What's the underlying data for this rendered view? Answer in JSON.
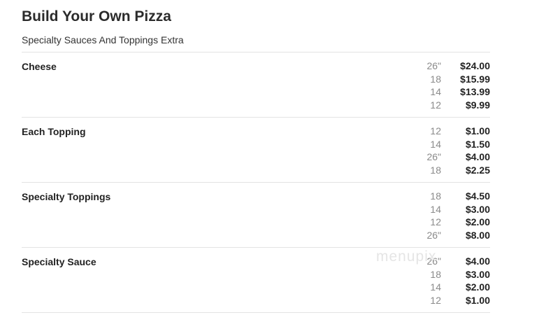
{
  "header": {
    "title": "Build Your Own Pizza",
    "subtitle": "Specialty Sauces And Toppings Extra"
  },
  "sections": [
    {
      "name": "Cheese",
      "prices": [
        {
          "size": "26\"",
          "price": "$24.00"
        },
        {
          "size": "18",
          "price": "$15.99"
        },
        {
          "size": "14",
          "price": "$13.99"
        },
        {
          "size": "12",
          "price": "$9.99"
        }
      ]
    },
    {
      "name": "Each Topping",
      "prices": [
        {
          "size": "12",
          "price": "$1.00"
        },
        {
          "size": "14",
          "price": "$1.50"
        },
        {
          "size": "26\"",
          "price": "$4.00"
        },
        {
          "size": "18",
          "price": "$2.25"
        }
      ]
    },
    {
      "name": "Specialty Toppings",
      "prices": [
        {
          "size": "18",
          "price": "$4.50"
        },
        {
          "size": "14",
          "price": "$3.00"
        },
        {
          "size": "12",
          "price": "$2.00"
        },
        {
          "size": "26\"",
          "price": "$8.00"
        }
      ]
    },
    {
      "name": "Specialty Sauce",
      "prices": [
        {
          "size": "26\"",
          "price": "$4.00"
        },
        {
          "size": "18",
          "price": "$3.00"
        },
        {
          "size": "14",
          "price": "$2.00"
        },
        {
          "size": "12",
          "price": "$1.00"
        }
      ]
    }
  ],
  "watermark": "menupix"
}
